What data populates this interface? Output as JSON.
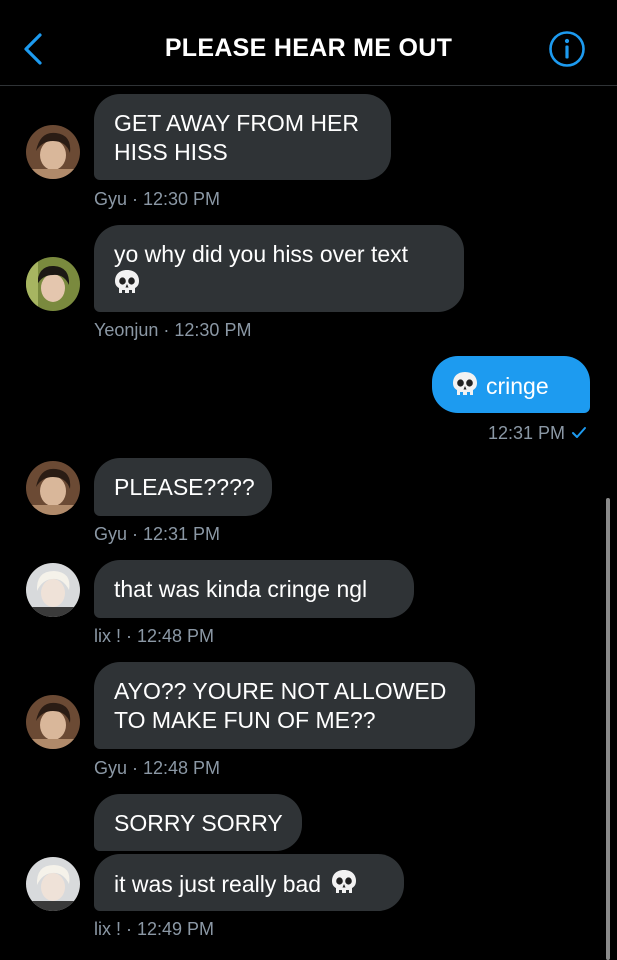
{
  "header": {
    "title": "PLEASE HEAR ME OUT",
    "back_icon": "chevron-left-icon",
    "info_icon": "info-icon",
    "accent_color": "#1d9bf0"
  },
  "messages": [
    {
      "lines": [
        "GET AWAY FROM HER",
        "HISS HISS"
      ],
      "meta": "Gyu · 12:30 PM"
    },
    {
      "lines": [
        "yo why did you hiss over text"
      ],
      "emoji": "skull-icon",
      "meta": "Yeonjun · 12:30 PM"
    },
    {
      "text": "cringe",
      "emoji": "skull-icon",
      "meta": "12:31 PM",
      "sent": true
    },
    {
      "text": "PLEASE????",
      "meta": "Gyu · 12:31 PM"
    },
    {
      "text": "that was kinda cringe ngl",
      "meta": "lix ! · 12:48 PM"
    },
    {
      "lines": [
        "AYO?? YOURE NOT ALLOWED",
        "TO MAKE FUN OF ME??"
      ],
      "meta": "Gyu · 12:48 PM"
    },
    {
      "text": "SORRY SORRY"
    },
    {
      "text": "it was just really bad",
      "emoji": "skull-icon",
      "meta": "lix ! · 12:49 PM"
    }
  ]
}
